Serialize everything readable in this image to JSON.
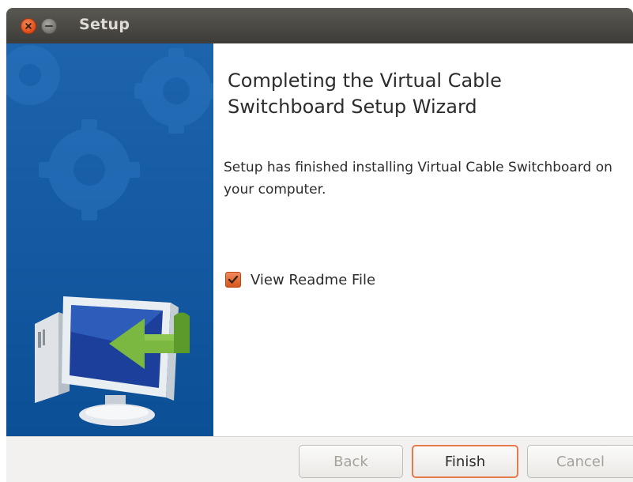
{
  "window": {
    "title": "Setup",
    "controls": {
      "close_icon": "close-icon",
      "minimize_icon": "minimize-icon"
    }
  },
  "banner": {
    "image": "computer-with-install-arrow",
    "decorations": "gears"
  },
  "content": {
    "heading": "Completing the Virtual Cable Switchboard Setup Wizard",
    "message": "Setup has finished installing Virtual Cable Switchboard on your computer.",
    "checkbox": {
      "label": "View Readme File",
      "checked": true
    }
  },
  "footer": {
    "buttons": {
      "back": "Back",
      "finish": "Finish",
      "cancel": "Cancel"
    }
  },
  "colors": {
    "accent": "#e0591e",
    "banner_blue": "#1560a8",
    "titlebar": "#3d3c38"
  }
}
